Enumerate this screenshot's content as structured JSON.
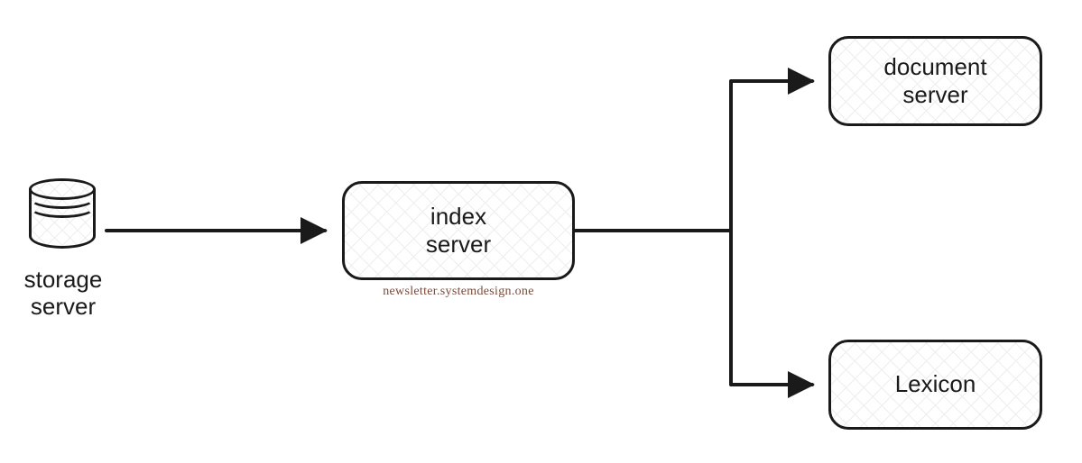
{
  "nodes": {
    "storage": {
      "label": "storage\nserver"
    },
    "index": {
      "label": "index\nserver"
    },
    "document": {
      "label": "document\nserver"
    },
    "lexicon": {
      "label": "Lexicon"
    }
  },
  "edges": [
    {
      "from": "storage",
      "to": "index"
    },
    {
      "from": "index",
      "to": "document"
    },
    {
      "from": "index",
      "to": "lexicon"
    }
  ],
  "watermark": "newsletter.systemdesign.one",
  "style": {
    "stroke": "#1a1a1a",
    "hatch": "#eeeeee",
    "watermark_color": "#7a4a3a"
  }
}
